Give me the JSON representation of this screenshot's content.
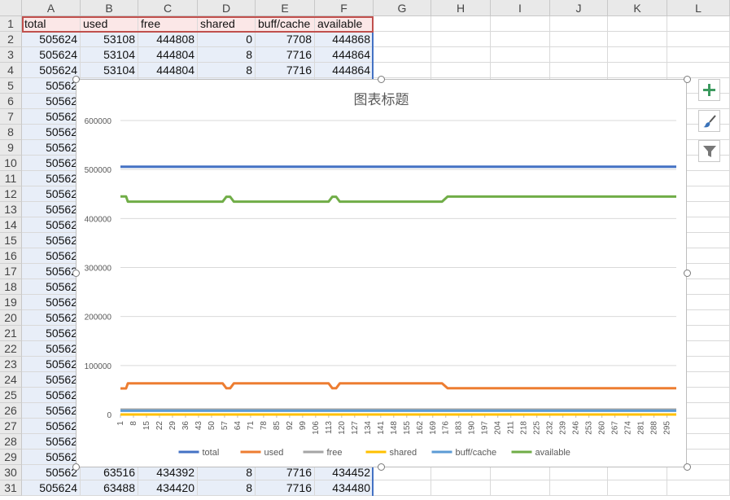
{
  "columns": [
    "A",
    "B",
    "C",
    "D",
    "E",
    "F",
    "G",
    "H",
    "I",
    "J",
    "K",
    "L"
  ],
  "header_row": [
    "total",
    "used",
    "free",
    "shared",
    "buff/cache",
    "available"
  ],
  "rows": [
    {
      "n": "1"
    },
    {
      "n": "2",
      "v": [
        "505624",
        "53108",
        "444808",
        "0",
        "7708",
        "444868"
      ]
    },
    {
      "n": "3",
      "v": [
        "505624",
        "53104",
        "444804",
        "8",
        "7716",
        "444864"
      ]
    },
    {
      "n": "4",
      "v": [
        "505624",
        "53104",
        "444804",
        "8",
        "7716",
        "444864"
      ]
    },
    {
      "n": "5",
      "v": [
        "50562"
      ]
    },
    {
      "n": "6",
      "v": [
        "50562"
      ]
    },
    {
      "n": "7",
      "v": [
        "50562"
      ]
    },
    {
      "n": "8",
      "v": [
        "50562"
      ]
    },
    {
      "n": "9",
      "v": [
        "50562"
      ]
    },
    {
      "n": "10",
      "v": [
        "50562"
      ]
    },
    {
      "n": "11",
      "v": [
        "50562"
      ]
    },
    {
      "n": "12",
      "v": [
        "50562"
      ]
    },
    {
      "n": "13",
      "v": [
        "50562"
      ]
    },
    {
      "n": "14",
      "v": [
        "50562"
      ]
    },
    {
      "n": "15",
      "v": [
        "50562"
      ]
    },
    {
      "n": "16",
      "v": [
        "50562"
      ]
    },
    {
      "n": "17",
      "v": [
        "50562"
      ]
    },
    {
      "n": "18",
      "v": [
        "50562"
      ]
    },
    {
      "n": "19",
      "v": [
        "50562"
      ]
    },
    {
      "n": "20",
      "v": [
        "50562"
      ]
    },
    {
      "n": "21",
      "v": [
        "50562"
      ]
    },
    {
      "n": "22",
      "v": [
        "50562"
      ]
    },
    {
      "n": "23",
      "v": [
        "50562"
      ]
    },
    {
      "n": "24",
      "v": [
        "50562"
      ]
    },
    {
      "n": "25",
      "v": [
        "50562"
      ]
    },
    {
      "n": "26",
      "v": [
        "50562"
      ]
    },
    {
      "n": "27",
      "v": [
        "50562"
      ]
    },
    {
      "n": "28",
      "v": [
        "50562"
      ]
    },
    {
      "n": "29",
      "v": [
        "50562"
      ]
    },
    {
      "n": "30",
      "v": [
        "50562",
        "63516",
        "434392",
        "8",
        "7716",
        "434452"
      ]
    },
    {
      "n": "31",
      "v": [
        "505624",
        "63488",
        "434420",
        "8",
        "7716",
        "434480"
      ]
    }
  ],
  "side_buttons": [
    {
      "name": "chart-elements-button",
      "icon": "plus-icon"
    },
    {
      "name": "chart-styles-button",
      "icon": "brush-icon"
    },
    {
      "name": "chart-filters-button",
      "icon": "filter-icon"
    }
  ],
  "chart_data": {
    "type": "line",
    "title": "图表标题",
    "ylim": [
      0,
      600000
    ],
    "yticks": [
      "600000",
      "500000",
      "400000",
      "300000",
      "200000",
      "100000",
      "0"
    ],
    "xticks": [
      "1",
      "8",
      "15",
      "22",
      "29",
      "36",
      "43",
      "50",
      "57",
      "64",
      "71",
      "78",
      "85",
      "92",
      "99",
      "106",
      "113",
      "120",
      "127",
      "134",
      "141",
      "148",
      "155",
      "162",
      "169",
      "176",
      "183",
      "190",
      "197",
      "204",
      "211",
      "218",
      "225",
      "232",
      "239",
      "246",
      "253",
      "260",
      "267",
      "274",
      "281",
      "288",
      "295"
    ],
    "x_range": [
      1,
      300
    ],
    "legend_position": "bottom",
    "grid": true,
    "series": [
      {
        "name": "total",
        "color": "#4472c4",
        "points": [
          [
            1,
            505624
          ],
          [
            300,
            505624
          ]
        ]
      },
      {
        "name": "used",
        "color": "#ed7d31",
        "points": [
          [
            1,
            53108
          ],
          [
            4,
            53104
          ],
          [
            5,
            63500
          ],
          [
            56,
            63500
          ],
          [
            58,
            53500
          ],
          [
            60,
            53500
          ],
          [
            62,
            63500
          ],
          [
            113,
            63500
          ],
          [
            115,
            53500
          ],
          [
            117,
            53500
          ],
          [
            119,
            63500
          ],
          [
            174,
            63500
          ],
          [
            177,
            53500
          ],
          [
            300,
            53500
          ]
        ]
      },
      {
        "name": "free",
        "color": "#a5a5a5",
        "points": [
          [
            1,
            10000
          ],
          [
            300,
            10000
          ]
        ]
      },
      {
        "name": "shared",
        "color": "#ffc000",
        "points": [
          [
            1,
            8
          ],
          [
            300,
            8
          ]
        ]
      },
      {
        "name": "buff/cache",
        "color": "#5b9bd5",
        "points": [
          [
            1,
            7708
          ],
          [
            300,
            7716
          ]
        ]
      },
      {
        "name": "available",
        "color": "#70ad47",
        "points": [
          [
            1,
            444868
          ],
          [
            4,
            444864
          ],
          [
            5,
            434500
          ],
          [
            56,
            434500
          ],
          [
            58,
            444500
          ],
          [
            60,
            444500
          ],
          [
            62,
            434500
          ],
          [
            113,
            434500
          ],
          [
            115,
            444500
          ],
          [
            117,
            444500
          ],
          [
            119,
            434500
          ],
          [
            174,
            434500
          ],
          [
            177,
            444800
          ],
          [
            300,
            444800
          ]
        ]
      }
    ]
  }
}
